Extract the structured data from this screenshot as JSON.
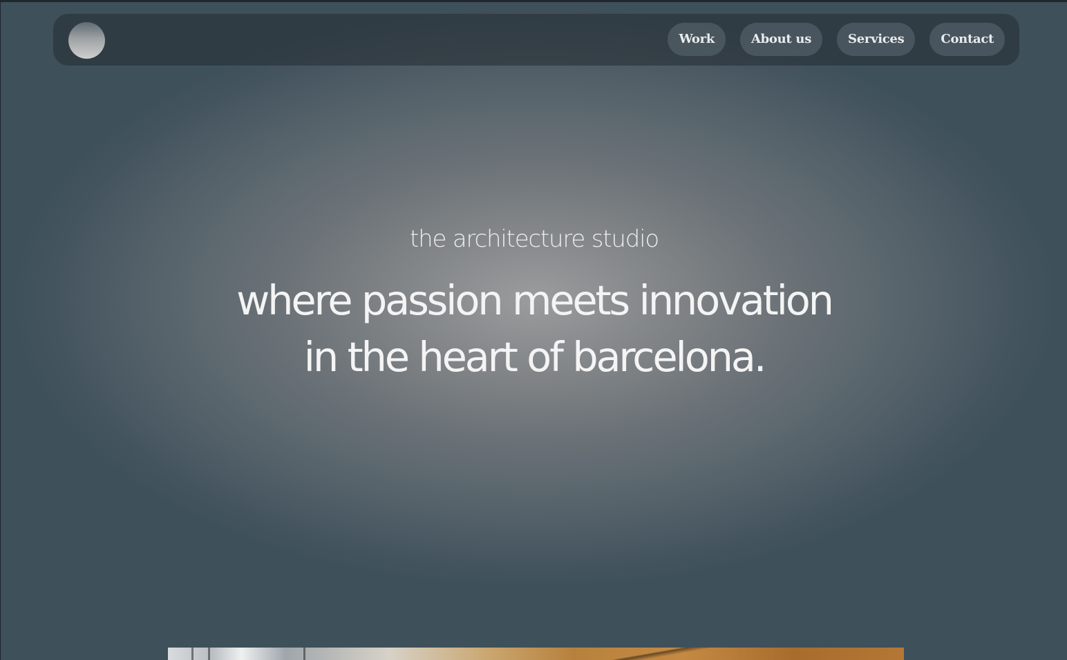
{
  "nav": {
    "logo": "circle-logo",
    "items": [
      {
        "label": "Work"
      },
      {
        "label": "About us"
      },
      {
        "label": "Services"
      },
      {
        "label": "Contact"
      }
    ]
  },
  "hero": {
    "eyebrow": "the architecture studio",
    "headline_line1": "where passion meets innovation",
    "headline_line2": "in the heart of barcelona."
  },
  "colors": {
    "background": "#3e505a",
    "navbar": "#283037",
    "nav_pill": "#535f68",
    "text": "#f2f2f2"
  }
}
